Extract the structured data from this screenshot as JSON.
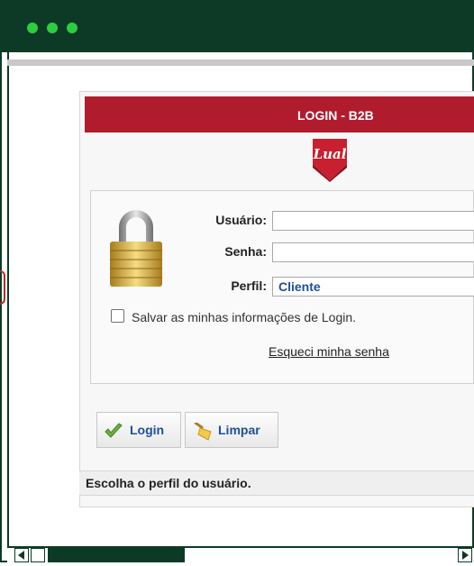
{
  "window": {
    "title_dots_color": "#2ecc40",
    "frame_color": "#0d3a26"
  },
  "login": {
    "header_title": "LOGIN - B2B",
    "logo_text": "Lual",
    "user_label": "Usuário:",
    "user_value": "",
    "password_label": "Senha:",
    "password_value": "",
    "profile_label": "Perfil:",
    "profile_selected": "Cliente",
    "remember_label": "Salvar as minhas informações de Login.",
    "remember_checked": false,
    "forgot_link": "Esqueci minha senha"
  },
  "buttons": {
    "login_label": "Login",
    "login_icon": "checkmark-icon",
    "clear_label": "Limpar",
    "clear_icon": "broom-icon"
  },
  "status": {
    "text": "Escolha o perfil do usuário."
  },
  "colors": {
    "header_red": "#b01c2e",
    "link_blue": "#1e4f9a"
  }
}
